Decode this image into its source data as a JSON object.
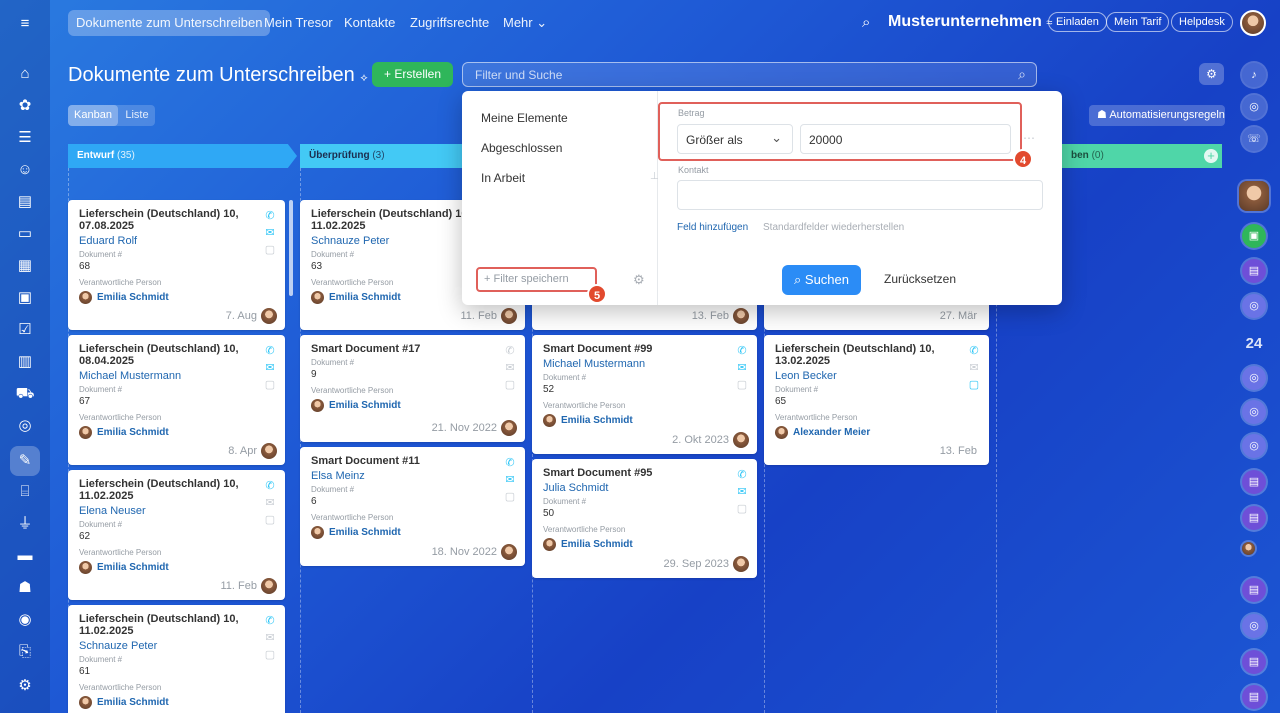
{
  "nav": {
    "menu_icon": "menu-icon",
    "items": [
      "Dokumente zum Unterschreiben",
      "Mein Tresor",
      "Kontakte",
      "Zugriffsrechte",
      "Mehr"
    ],
    "company": "Musterunternehmen",
    "buttons": [
      "Einladen",
      "Mein Tarif",
      "Helpdesk"
    ]
  },
  "page": {
    "title": "Dokumente zum Unterschreiben",
    "create_label": "+ Erstellen",
    "search_placeholder": "Filter und Suche",
    "view_kanban": "Kanban",
    "view_list": "Liste",
    "automation": "Automatisierungsregeln"
  },
  "columns": [
    {
      "name": "Entwurf",
      "count": "(35)"
    },
    {
      "name": "Überprüfung",
      "count": "(3)"
    },
    {
      "name": "ben",
      "count": "(0)"
    }
  ],
  "filter": {
    "presets": [
      "Meine Elemente",
      "Abgeschlossen",
      "In Arbeit"
    ],
    "save_filter": "+ Filter speichern",
    "betrag_label": "Betrag",
    "betrag_op": "Größer als",
    "betrag_value": "20000",
    "kontakt_label": "Kontakt",
    "add_field": "Feld hinzufügen",
    "restore": "Standardfelder wiederherstellen",
    "search": "Suchen",
    "reset": "Zurücksetzen",
    "badge4": "4",
    "badge5": "5"
  },
  "cards": {
    "c1": {
      "title": "Lieferschein (Deutschland) 10, 07.08.2025",
      "contact": "Eduard Rolf",
      "doc_label": "Dokument #",
      "doc": "68",
      "resp_label": "Verantwortliche Person",
      "person": "Emilia Schmidt",
      "date": "7. Aug"
    },
    "c2": {
      "title": "Lieferschein (Deutschland) 10, 08.04.2025",
      "contact": "Michael Mustermann",
      "doc_label": "Dokument #",
      "doc": "67",
      "resp_label": "Verantwortliche Person",
      "person": "Emilia Schmidt",
      "date": "8. Apr"
    },
    "c3": {
      "title": "Lieferschein (Deutschland) 10, 11.02.2025",
      "contact": "Elena Neuser",
      "doc_label": "Dokument #",
      "doc": "62",
      "resp_label": "Verantwortliche Person",
      "person": "Emilia Schmidt",
      "date": "11. Feb"
    },
    "c4": {
      "title": "Lieferschein (Deutschland) 10, 11.02.2025",
      "contact": "Schnauze Peter",
      "doc_label": "Dokument #",
      "doc": "61",
      "resp_label": "Verantwortliche Person",
      "person": "Emilia Schmidt"
    },
    "c5": {
      "title": "Lieferschein (Deutschland) 10, 11.02.2025",
      "contact": "Schnauze Peter",
      "doc_label": "Dokument #",
      "doc": "63",
      "resp_label": "Verantwortliche Person",
      "person": "Emilia Schmidt",
      "date": "11. Feb"
    },
    "c6": {
      "title": "Smart Document #17",
      "doc_label": "Dokument #",
      "doc": "9",
      "resp_label": "Verantwortliche Person",
      "person": "Emilia Schmidt",
      "date": "21. Nov 2022"
    },
    "c7": {
      "title": "Smart Document #11",
      "contact": "Elsa Meinz",
      "doc_label": "Dokument #",
      "doc": "6",
      "resp_label": "Verantwortliche Person",
      "person": "Emilia Schmidt",
      "date": "18. Nov 2022"
    },
    "c8": {
      "date": "13. Feb"
    },
    "c9": {
      "title": "Smart Document #99",
      "contact": "Michael Mustermann",
      "doc_label": "Dokument #",
      "doc": "52",
      "resp_label": "Verantwortliche Person",
      "person": "Emilia Schmidt",
      "date": "2. Okt 2023"
    },
    "c10": {
      "title": "Smart Document #95",
      "contact": "Julia Schmidt",
      "doc_label": "Dokument #",
      "doc": "50",
      "resp_label": "Verantwortliche Person",
      "person": "Emilia Schmidt",
      "date": "29. Sep 2023"
    },
    "c11": {
      "date": "27. Mär"
    },
    "c12": {
      "title": "Lieferschein (Deutschland) 10, 13.02.2025",
      "contact": "Leon Becker",
      "doc_label": "Dokument #",
      "doc": "65",
      "resp_label": "Verantwortliche Person",
      "person": "Alexander Meier",
      "date": "13. Feb"
    }
  },
  "rightbar": {
    "counter": "24"
  }
}
